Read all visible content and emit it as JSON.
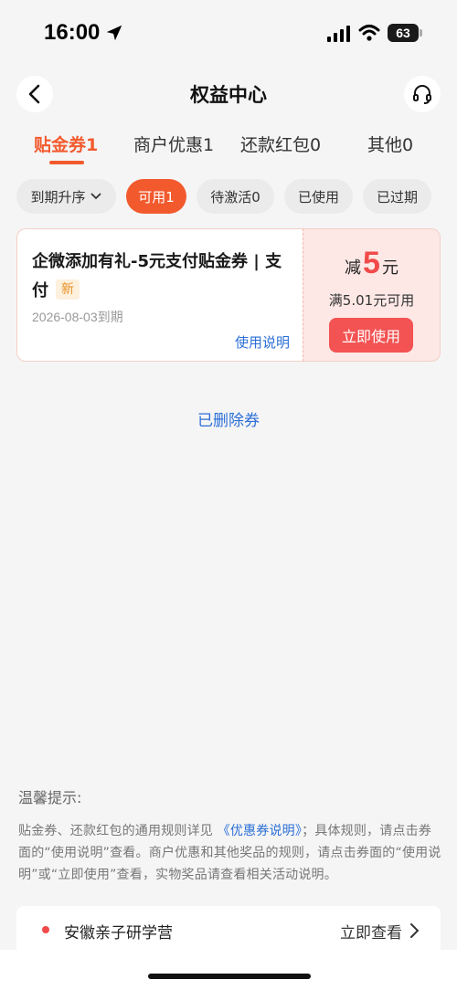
{
  "status_bar": {
    "time": "16:00",
    "battery": "63",
    "icons": [
      "location-arrow-icon",
      "signal-icon",
      "wifi-icon",
      "battery-icon"
    ]
  },
  "header": {
    "title": "权益中心",
    "icons": [
      "back-chevron-icon",
      "headset-icon"
    ]
  },
  "tabs": [
    {
      "label": "贴金券1",
      "active": true
    },
    {
      "label": "商户优惠1",
      "active": false
    },
    {
      "label": "还款红包0",
      "active": false
    },
    {
      "label": "其他0",
      "active": false
    }
  ],
  "filters": {
    "sort_label": "到期升序",
    "chips": [
      {
        "label": "可用1",
        "active": true
      },
      {
        "label": "待激活0",
        "active": false
      },
      {
        "label": "已使用",
        "active": false
      },
      {
        "label": "已过期",
        "active": false
      }
    ]
  },
  "coupon": {
    "title": "企微添加有礼-5元支付贴金券 | 支付",
    "badge": "新",
    "expiry": "2026-08-03到期",
    "usage_link": "使用说明",
    "discount_prefix": "减",
    "discount_amount": "5",
    "discount_unit": "元",
    "threshold": "满5.01元可用",
    "use_button": "立即使用"
  },
  "deleted_link": "已删除券",
  "tips": {
    "heading": "温馨提示:",
    "body_part1": "贴金券、还款红包的通用规则详见",
    "link": "《优惠券说明》",
    "body_part2": "；具体规则，请点击券面的“使用说明”查看。商户优惠和其他奖品的规则，请点击券面的“使用说明”或“立即使用”查看，实物奖品请查看相关活动说明。"
  },
  "banner": {
    "title": "安徽亲子研学营",
    "link": "立即查看"
  },
  "colors": {
    "accent": "#f25a2e",
    "discount_red": "#f04a4a",
    "link_blue": "#2b6fd6",
    "coupon_bg": "#fde8e5"
  }
}
